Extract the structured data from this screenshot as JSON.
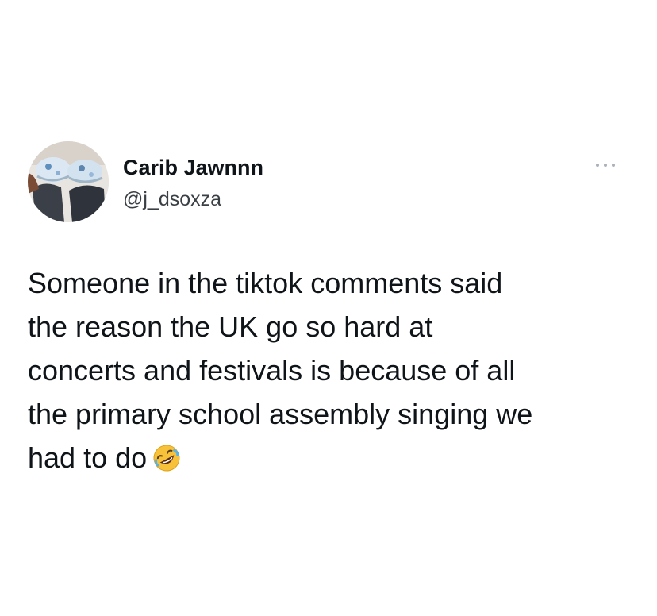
{
  "author": {
    "display_name": "Carib Jawnnn",
    "handle": "@j_dsoxza",
    "avatar_icon": "avatar-photo-feet-sneakers"
  },
  "menu": {
    "icon": "more-dots-icon"
  },
  "tweet": {
    "lines": [
      "Someone in the tiktok comments said",
      "the reason the UK go so hard at",
      "concerts and festivals is because of all",
      "the primary school assembly singing we",
      "had to do"
    ],
    "emoji": "rolling-on-the-floor-laughing-emoji"
  },
  "colors": {
    "text": "#0f1419",
    "secondary_text": "#3a3f44",
    "emoji_face": "#f7c23a",
    "background": "#ffffff"
  }
}
